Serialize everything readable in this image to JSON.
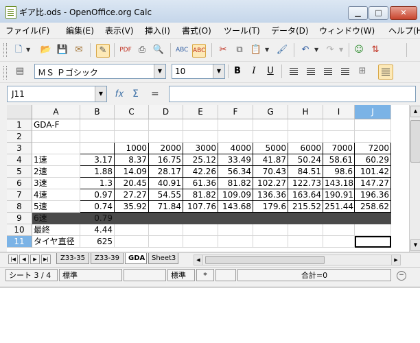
{
  "window": {
    "title": "ギア比.ods - OpenOffice.org Calc",
    "min": "▁",
    "max": "□",
    "close": "✕"
  },
  "menu": [
    "ファイル(F)",
    "編集(E)",
    "表示(V)",
    "挿入(I)",
    "書式(O)",
    "ツール(T)",
    "データ(D)",
    "ウィンドウ(W)",
    "ヘルプ(H)"
  ],
  "formatting": {
    "font_name": "ＭＳ Ｐゴシック",
    "font_size": "10"
  },
  "namebox": {
    "value": "J11"
  },
  "formula": {
    "value": ""
  },
  "columns": [
    "A",
    "B",
    "C",
    "D",
    "E",
    "F",
    "G",
    "H",
    "I",
    "J"
  ],
  "rows": [
    "1",
    "2",
    "3",
    "4",
    "5",
    "6",
    "7",
    "8",
    "9",
    "10",
    "11"
  ],
  "cells": {
    "r1": {
      "a": "GDA-F"
    },
    "r3": {
      "c": "1000",
      "d": "2000",
      "e": "3000",
      "f": "4000",
      "g": "5000",
      "h": "6000",
      "i": "7000",
      "j": "7200"
    },
    "r4": {
      "a": "1速",
      "b": "3.17",
      "c": "8.37",
      "d": "16.75",
      "e": "25.12",
      "f": "33.49",
      "g": "41.87",
      "h": "50.24",
      "i": "58.61",
      "j": "60.29"
    },
    "r5": {
      "a": "2速",
      "b": "1.88",
      "c": "14.09",
      "d": "28.17",
      "e": "42.26",
      "f": "56.34",
      "g": "70.43",
      "h": "84.51",
      "i": "98.6",
      "j": "101.42"
    },
    "r6": {
      "a": "3速",
      "b": "1.3",
      "c": "20.45",
      "d": "40.91",
      "e": "61.36",
      "f": "81.82",
      "g": "102.27",
      "h": "122.73",
      "i": "143.18",
      "j": "147.27"
    },
    "r7": {
      "a": "4速",
      "b": "0.97",
      "c": "27.27",
      "d": "54.55",
      "e": "81.82",
      "f": "109.09",
      "g": "136.36",
      "h": "163.64",
      "i": "190.91",
      "j": "196.36"
    },
    "r8": {
      "a": "5速",
      "b": "0.74",
      "c": "35.92",
      "d": "71.84",
      "e": "107.76",
      "f": "143.68",
      "g": "179.6",
      "h": "215.52",
      "i": "251.44",
      "j": "258.62"
    },
    "r9": {
      "a": "6速",
      "b": "0.79"
    },
    "r10": {
      "a": "最終",
      "b": "4.44"
    },
    "r11": {
      "a": "タイヤ直径",
      "b": "625"
    }
  },
  "sheet_tabs": [
    "Z33-35",
    "Z33-39",
    "GDA",
    "Sheet3"
  ],
  "active_sheet": "GDA",
  "status": {
    "sheet": "シート 3 / 4",
    "style": "標準",
    "zoom_style": "標準",
    "mode": "*",
    "sum": "合計=0"
  },
  "colors": {
    "selection_header": "#7bb3e6",
    "dark_row": "#4a4a4a"
  },
  "icons": [
    "new-icon",
    "open-icon",
    "save-icon",
    "mail-icon",
    "edit-icon",
    "pdf-icon",
    "print-icon",
    "print-preview-icon",
    "spellcheck-icon",
    "auto-spellcheck-icon",
    "cut-icon",
    "copy-icon",
    "paste-icon",
    "clone-format-icon",
    "undo-icon",
    "redo-icon",
    "navigator-icon",
    "sort-icon",
    "bold-icon",
    "italic-icon",
    "underline-icon",
    "align-left-icon",
    "align-center-icon",
    "align-right-icon",
    "justify-icon",
    "merge-icon",
    "wrap-icon",
    "function-wizard-icon",
    "sum-icon",
    "equals-icon"
  ]
}
